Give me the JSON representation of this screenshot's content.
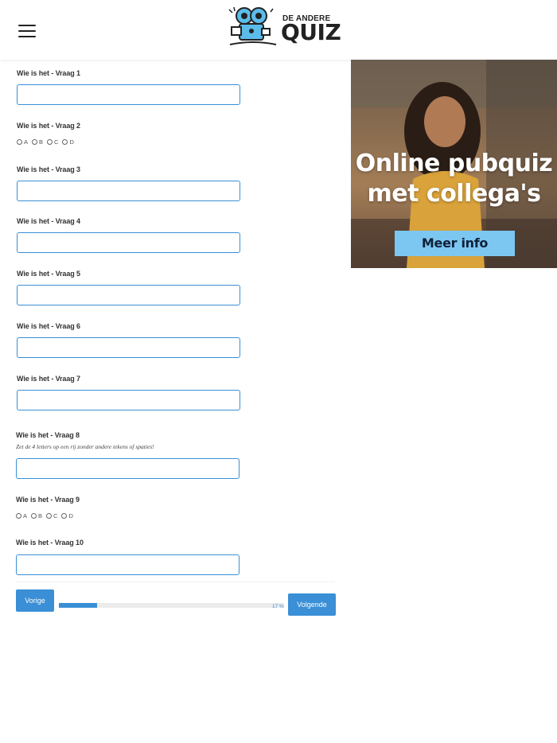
{
  "header": {
    "menu_icon": "hamburger-icon",
    "logo": {
      "small": "DE ANDERE",
      "big": "QUIZ"
    }
  },
  "questions": [
    {
      "label": "Wie is het - Vraag 1",
      "type": "text",
      "value": ""
    },
    {
      "label": "Wie is het - Vraag 2",
      "type": "radio",
      "options": [
        "A",
        "B",
        "C",
        "D"
      ]
    },
    {
      "label": "Wie is het - Vraag 3",
      "type": "text",
      "value": ""
    },
    {
      "label": "Wie is het - Vraag 4",
      "type": "text",
      "value": ""
    },
    {
      "label": "Wie is het - Vraag 5",
      "type": "text",
      "value": ""
    },
    {
      "label": "Wie is het - Vraag 6",
      "type": "text",
      "value": ""
    },
    {
      "label": "Wie is het - Vraag 7",
      "type": "text",
      "value": ""
    },
    {
      "label": "Wie is het - Vraag 8",
      "hint": "Zet de 4 letters op een rij zonder andere tekens of spaties!",
      "type": "text",
      "value": ""
    },
    {
      "label": "Wie is het - Vraag 9",
      "type": "radio",
      "options": [
        "A",
        "B",
        "C",
        "D"
      ]
    },
    {
      "label": "Wie is het - Vraag 10",
      "type": "text",
      "value": ""
    }
  ],
  "ad": {
    "line1": "Online pubquiz",
    "line2": "met collega's",
    "cta": "Meer info"
  },
  "nav": {
    "prev_label": "Vorige",
    "next_label": "Volgende",
    "progress_text": "17 %",
    "progress_fraction": 0.17
  },
  "colors": {
    "accent": "#3a8fd6",
    "ad_button": "#7cc7f2"
  }
}
